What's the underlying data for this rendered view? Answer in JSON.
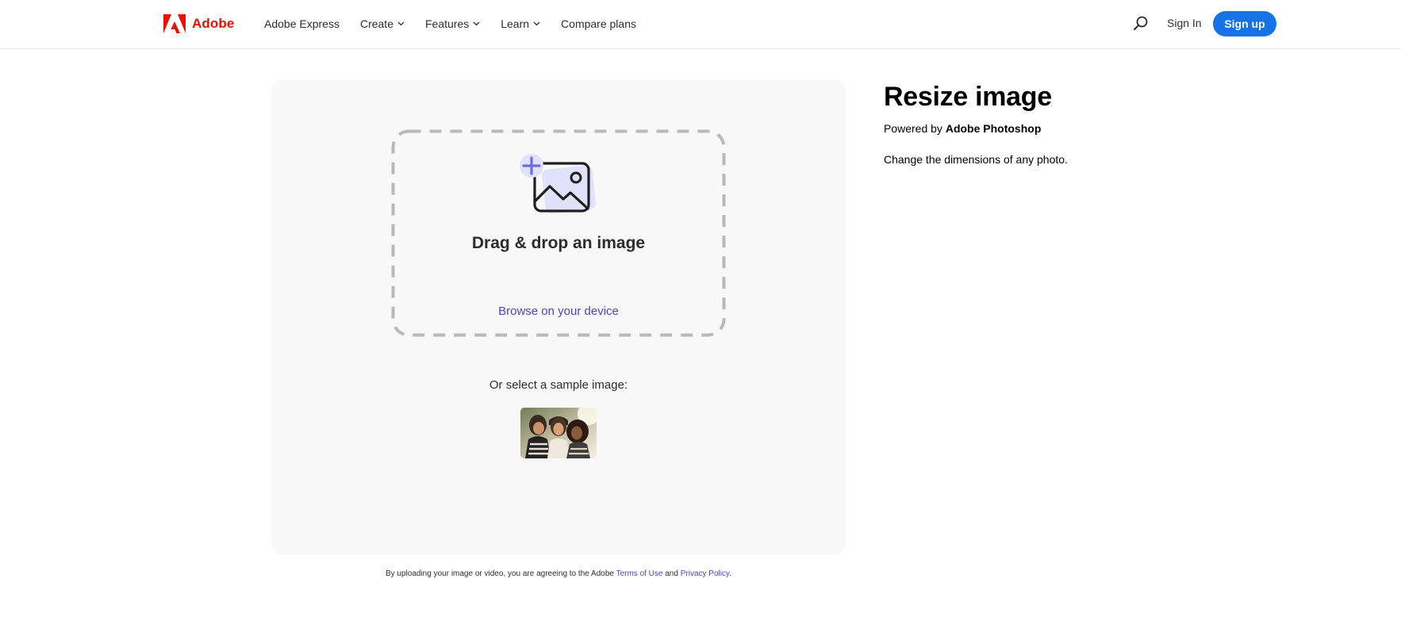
{
  "header": {
    "logo_text": "Adobe",
    "nav": [
      {
        "label": "Adobe Express",
        "has_dropdown": false
      },
      {
        "label": "Create",
        "has_dropdown": true
      },
      {
        "label": "Features",
        "has_dropdown": true
      },
      {
        "label": "Learn",
        "has_dropdown": true
      },
      {
        "label": "Compare plans",
        "has_dropdown": false
      }
    ],
    "search_icon": "search-icon",
    "sign_in": "Sign In",
    "sign_up": "Sign up"
  },
  "upload": {
    "icon": "add-image-icon",
    "title": "Drag & drop an image",
    "browse": "Browse on your device",
    "sample_label": "Or select a sample image:",
    "sample_image": "sample-photo-three-friends"
  },
  "disclaimer": {
    "prefix": "By uploading your image or video, you are agreeing to the Adobe ",
    "terms": "Terms of Use",
    "and": " and ",
    "privacy": "Privacy Policy",
    "suffix": "."
  },
  "info": {
    "title": "Resize image",
    "powered_prefix": "Powered by ",
    "powered_product": "Adobe Photoshop",
    "description": "Change the dimensions of any photo."
  },
  "colors": {
    "brand_red": "#eb1000",
    "primary_blue": "#1473e6",
    "link_purple": "#4a47c7",
    "panel_bg": "#f8f8f8",
    "dash_border": "#b9b9b9",
    "icon_accent": "#6e6ce0",
    "icon_accent_bg": "#e2e1fb"
  }
}
